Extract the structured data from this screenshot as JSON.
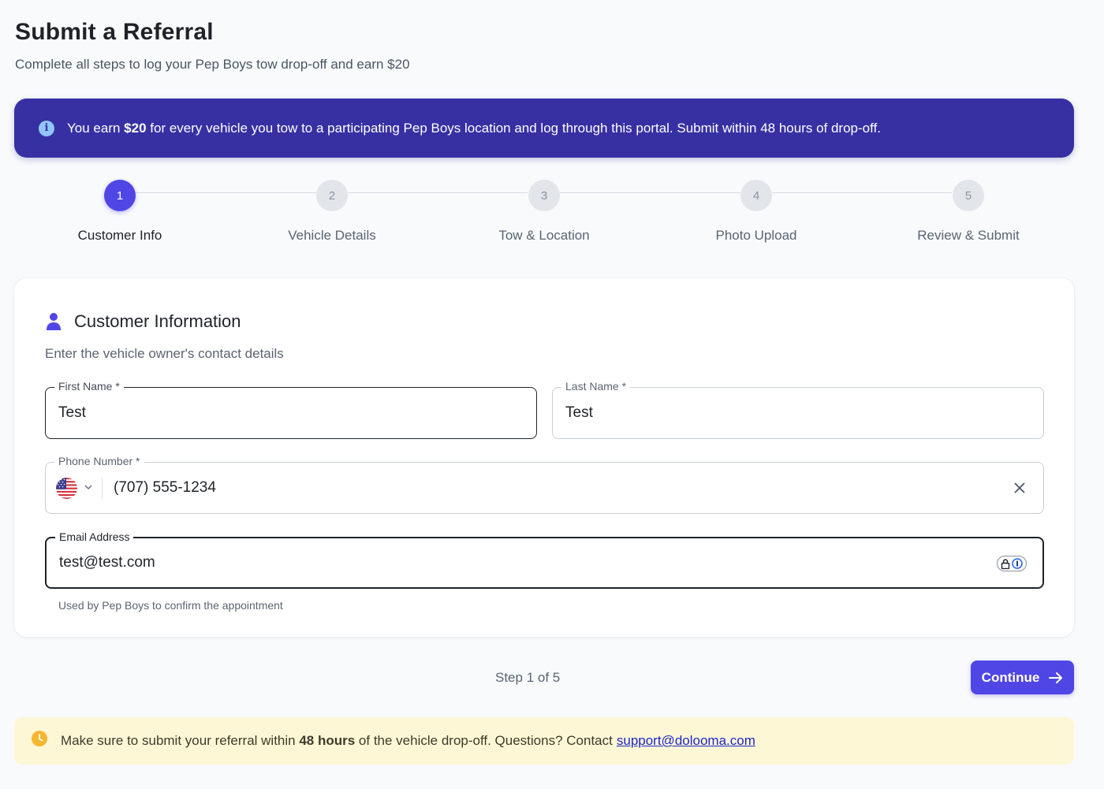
{
  "header": {
    "title": "Submit a Referral",
    "subtitle": "Complete all steps to log your Pep Boys tow drop-off and earn $20"
  },
  "info_banner": {
    "icon": "info-icon",
    "text_before": "You earn ",
    "amount": "$20",
    "text_after": " for every vehicle you tow to a participating Pep Boys location and log through this portal. Submit within 48 hours of drop-off."
  },
  "stepper": {
    "current": 1,
    "steps": [
      {
        "number": "1",
        "label": "Customer Info"
      },
      {
        "number": "2",
        "label": "Vehicle Details"
      },
      {
        "number": "3",
        "label": "Tow & Location"
      },
      {
        "number": "4",
        "label": "Photo Upload"
      },
      {
        "number": "5",
        "label": "Review & Submit"
      }
    ]
  },
  "card": {
    "icon": "person-icon",
    "title": "Customer Information",
    "subtitle": "Enter the vehicle owner's contact details",
    "fields": {
      "first_name": {
        "label": "First Name *",
        "value": "Test"
      },
      "last_name": {
        "label": "Last Name *",
        "value": "Test"
      },
      "phone": {
        "label": "Phone Number *",
        "country_flag": "us-flag-icon",
        "value": "(707) 555-1234"
      },
      "email": {
        "label": "Email Address",
        "value": "test@test.com",
        "helper": "Used by Pep Boys to confirm the appointment"
      }
    }
  },
  "footer": {
    "step_count": "Step 1 of 5",
    "continue_label": "Continue"
  },
  "warning_banner": {
    "icon": "clock-icon",
    "text_before": "Make sure to submit your referral within ",
    "bold": "48 hours",
    "text_after": " of the vehicle drop-off. Questions? Contact",
    "link": "support@dolooma.com"
  },
  "colors": {
    "primary": "#4f46e5",
    "banner": "#3730a3",
    "warning_bg": "#fef7d6",
    "warning_icon": "#f5b731"
  }
}
